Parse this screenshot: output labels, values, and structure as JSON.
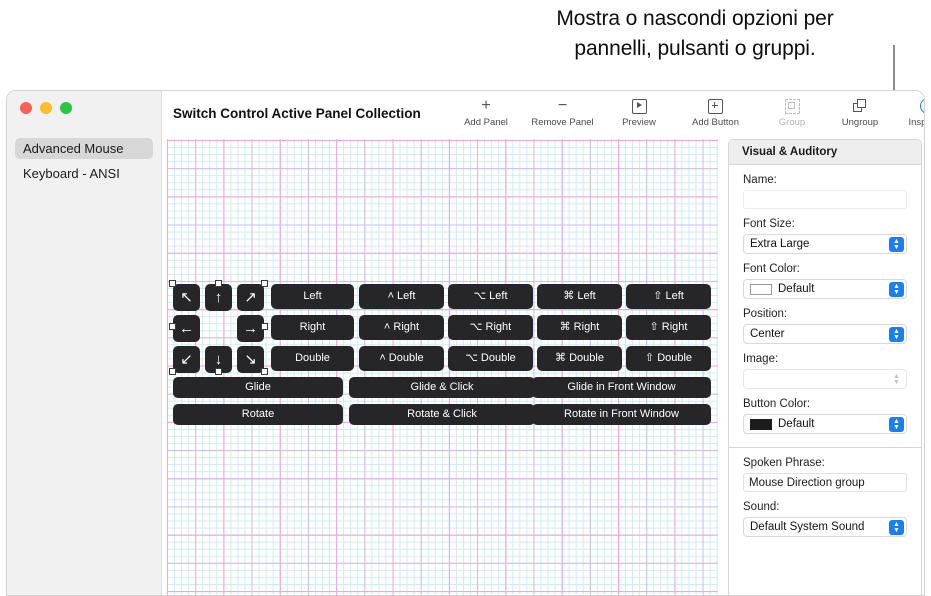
{
  "callout": {
    "line1": "Mostra o nascondi opzioni per",
    "line2": "pannelli, pulsanti o gruppi."
  },
  "window": {
    "title": "Switch Control Active Panel Collection"
  },
  "sidebar": {
    "items": [
      {
        "label": "Advanced Mouse",
        "selected": true
      },
      {
        "label": "Keyboard - ANSI",
        "selected": false
      }
    ]
  },
  "toolbar": {
    "items": [
      {
        "label": "Add Panel",
        "icon": "plus-icon",
        "enabled": true
      },
      {
        "label": "Remove Panel",
        "icon": "minus-icon",
        "enabled": true
      },
      {
        "label": "Preview",
        "icon": "play-box-icon",
        "enabled": true
      },
      {
        "label": "Add Button",
        "icon": "plus-box-icon",
        "enabled": true
      },
      {
        "label": "Group",
        "icon": "group-icon",
        "enabled": false
      },
      {
        "label": "Ungroup",
        "icon": "ungroup-icon",
        "enabled": true
      },
      {
        "label": "Inspector",
        "icon": "info-circle-icon",
        "enabled": true
      }
    ],
    "plus_glyph": "+",
    "minus_glyph": "−",
    "info_glyph": "i"
  },
  "canvas": {
    "arrow_buttons": [
      "↖",
      "↑",
      "↗",
      "←",
      "",
      "→",
      "↙",
      "↓",
      "↘"
    ],
    "action_buttons": [
      "Left",
      "˄ Left",
      "⌥ Left",
      "⌘ Left",
      "⇧ Left",
      "Right",
      "˄ Right",
      "⌥ Right",
      "⌘ Right",
      "⇧ Right",
      "Double",
      "˄ Double",
      "⌥ Double",
      "⌘ Double",
      "⇧ Double"
    ],
    "wide_buttons": [
      "Glide",
      "Glide & Click",
      "Glide in Front Window",
      "Rotate",
      "Rotate & Click",
      "Rotate in Front Window"
    ]
  },
  "inspector": {
    "header": "Visual & Auditory",
    "fields": {
      "name_label": "Name:",
      "name_value": "",
      "font_size_label": "Font Size:",
      "font_size_value": "Extra Large",
      "font_color_label": "Font Color:",
      "font_color_value": "Default",
      "font_color_swatch": "#ffffff",
      "position_label": "Position:",
      "position_value": "Center",
      "image_label": "Image:",
      "image_value": "",
      "button_color_label": "Button Color:",
      "button_color_value": "Default",
      "button_color_swatch": "#1c1c1c",
      "spoken_phrase_label": "Spoken Phrase:",
      "spoken_phrase_value": "Mouse Direction group",
      "sound_label": "Sound:",
      "sound_value": "Default System Sound"
    }
  },
  "colors": {
    "accent": "#1a7ef5",
    "button_dark": "#262628"
  }
}
